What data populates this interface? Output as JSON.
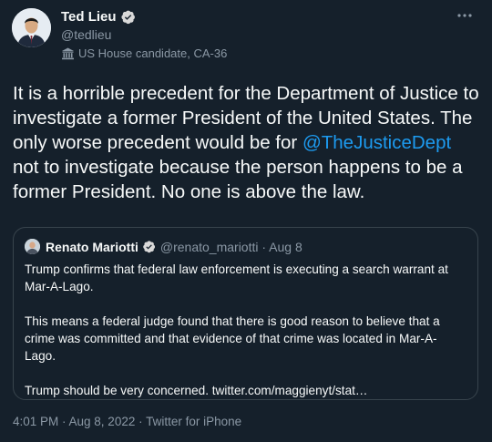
{
  "author": {
    "name": "Ted Lieu",
    "handle": "@tedlieu",
    "label": "US House candidate, CA-36"
  },
  "tweet": {
    "text_before": "It is a horrible precedent for the Department of Justice to investigate a former President of the United States. The only worse precedent would be for ",
    "mention": "@TheJusticeDept",
    "text_after": " not to investigate because the person happens to be a former President. No one is above the law."
  },
  "quoted": {
    "name": "Renato Mariotti",
    "handle": "@renato_mariotti · Aug 8",
    "paragraphs": [
      "Trump confirms that federal law enforcement is executing a search warrant at Mar-A-Lago.",
      "This means a federal judge found that there is good reason to believe that a crime was committed and that evidence of that crime was located in Mar-A-Lago.",
      "Trump should be very concerned. twitter.com/maggienyt/stat…"
    ]
  },
  "meta": "4:01 PM · Aug 8, 2022 · Twitter for iPhone",
  "colors": {
    "background": "#15202b",
    "text": "#f7f9f9",
    "secondary": "#8b98a5",
    "accent": "#1d9bf0",
    "border": "#38444d"
  },
  "icons": {
    "verified": "verified-badge-icon",
    "more": "more-options-icon",
    "label": "government-building-icon"
  }
}
